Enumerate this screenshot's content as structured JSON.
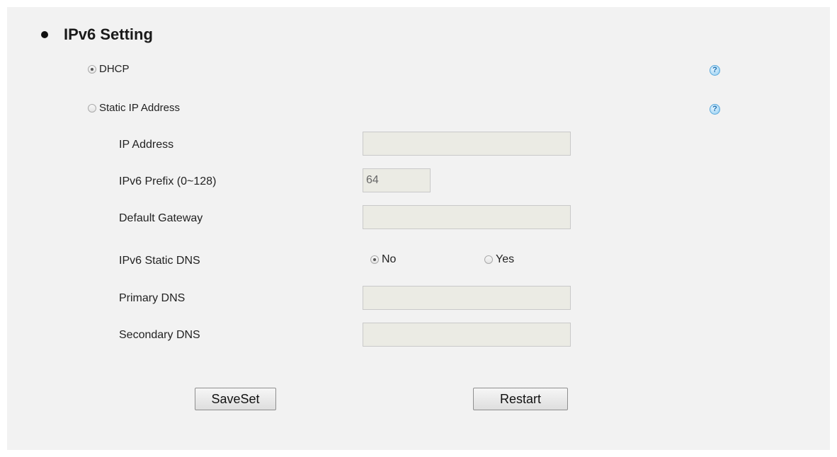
{
  "section": {
    "title": "IPv6 Setting"
  },
  "mode": {
    "dhcp_label": "DHCP",
    "static_label": "Static IP Address",
    "selected": "DHCP",
    "help_glyph": "?"
  },
  "fields": {
    "ip_address": {
      "label": "IP Address",
      "value": ""
    },
    "prefix": {
      "label": "IPv6 Prefix (0~128)",
      "value": "64"
    },
    "gateway": {
      "label": "Default Gateway",
      "value": ""
    },
    "static_dns": {
      "label": "IPv6 Static DNS",
      "no_label": "No",
      "yes_label": "Yes",
      "selected": "No"
    },
    "primary_dns": {
      "label": "Primary DNS",
      "value": ""
    },
    "secondary_dns": {
      "label": "Secondary DNS",
      "value": ""
    }
  },
  "buttons": {
    "save": "SaveSet",
    "restart": "Restart"
  },
  "colors": {
    "panel_bg": "#f2f2f2",
    "disabled_input_bg": "#ebebe4",
    "help_icon": "#5aa8da"
  },
  "icons": {
    "help": "help-icon",
    "bullet": "bullet-icon"
  }
}
